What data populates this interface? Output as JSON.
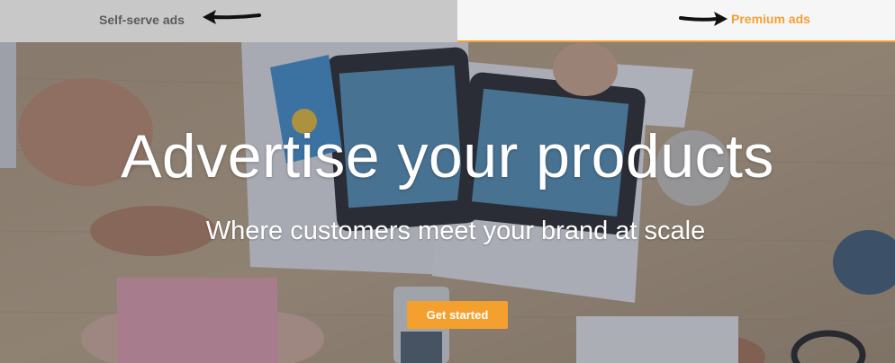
{
  "tabs": {
    "self_serve": {
      "label": "Self-serve ads",
      "state": "inactive"
    },
    "premium": {
      "label": "Premium ads",
      "state": "active"
    }
  },
  "hero": {
    "title": "Advertise your products",
    "subtitle": "Where customers meet your brand at scale",
    "cta_label": "Get started",
    "background_description_icon": "desk-with-tablets-photo"
  },
  "colors": {
    "accent": "#f2a033",
    "cta": "#f4a02e",
    "inactive_tab": "#c8c8c8",
    "active_tab": "#f6f6f6",
    "inactive_text": "#5b5b5b",
    "hero_text": "#ffffff"
  },
  "annotations": {
    "arrows": [
      "arrow-left-icon",
      "arrow-right-icon"
    ]
  }
}
